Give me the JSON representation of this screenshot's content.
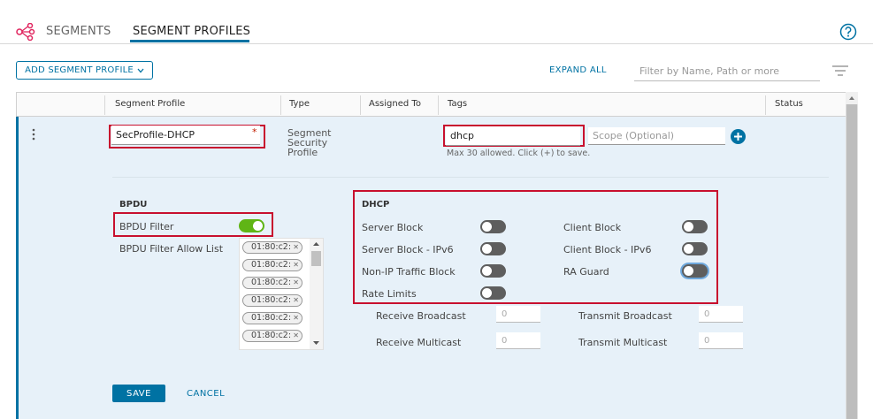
{
  "tabs": [
    {
      "label": "SEGMENTS"
    },
    {
      "label": "SEGMENT PROFILES"
    }
  ],
  "toolbar": {
    "add_label": "ADD SEGMENT PROFILE",
    "expand_label": "EXPAND ALL",
    "filter_placeholder": "Filter by Name, Path or more"
  },
  "columns": [
    "Segment Profile",
    "Type",
    "Assigned To",
    "Tags",
    "Status"
  ],
  "row": {
    "name": "SecProfile-DHCP",
    "required_mark": "*",
    "type_lines": [
      "Segment",
      "Security",
      "Profile"
    ],
    "tag_value": "dhcp",
    "scope_placeholder": "Scope (Optional)",
    "tag_hint": "Max 30 allowed. Click (+) to save."
  },
  "bpdu": {
    "title": "BPDU",
    "filter_label": "BPDU Filter",
    "filter_on": true,
    "allow_list_label": "BPDU Filter Allow List",
    "allow_list": [
      "01:80:c2:",
      "01:80:c2:",
      "01:80:c2:",
      "01:80:c2:",
      "01:80:c2:",
      "01:80:c2:"
    ]
  },
  "dhcp": {
    "title": "DHCP",
    "left": [
      {
        "label": "Server Block",
        "on": false
      },
      {
        "label": "Server Block - IPv6",
        "on": false
      },
      {
        "label": "Non-IP Traffic Block",
        "on": false
      },
      {
        "label": "Rate Limits",
        "on": false
      }
    ],
    "right": [
      {
        "label": "Client Block",
        "on": false
      },
      {
        "label": "Client Block - IPv6",
        "on": false
      },
      {
        "label": "RA Guard",
        "on": false
      }
    ]
  },
  "rate_limits": {
    "receive_broadcast_label": "Receive Broadcast",
    "receive_broadcast": "0",
    "transmit_broadcast_label": "Transmit Broadcast",
    "transmit_broadcast": "0",
    "receive_multicast_label": "Receive Multicast",
    "receive_multicast": "0",
    "transmit_multicast_label": "Transmit Multicast",
    "transmit_multicast": "0"
  },
  "actions": {
    "save_label": "SAVE",
    "cancel_label": "CANCEL"
  },
  "colors": {
    "accent": "#0072a3",
    "toggle_on": "#60b515",
    "toggle_off": "#5e5e5e",
    "highlight": "#c8102e",
    "brand": "#e0245e"
  }
}
